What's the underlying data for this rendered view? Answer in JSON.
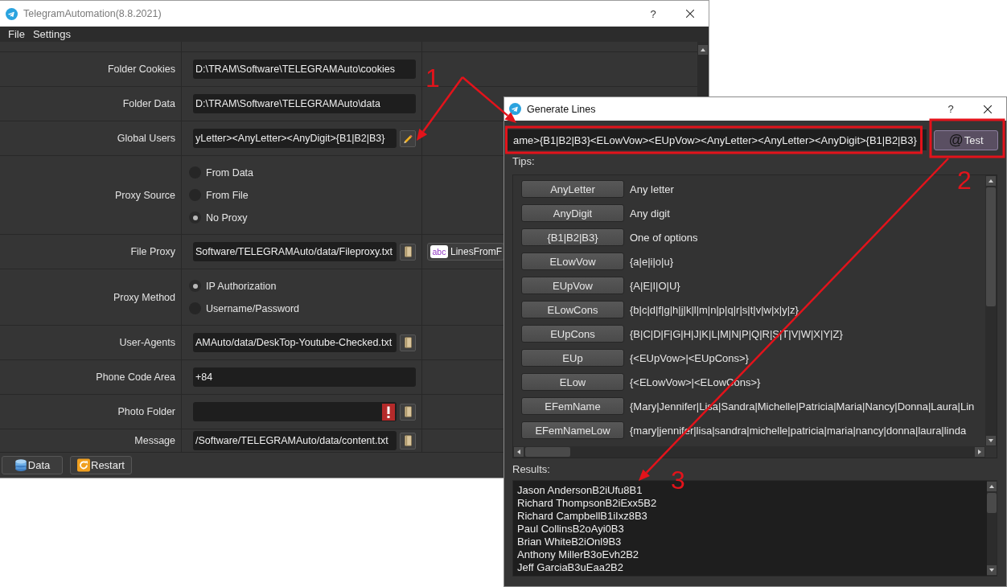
{
  "main_window": {
    "title": "TelegramAutomation(8.8.2021)",
    "help": "?",
    "menu": [
      "File",
      "Settings"
    ],
    "settings": [
      {
        "kind": "text",
        "label": "Folder Cookies",
        "value": "D:\\TRAM\\Software\\TELEGRAMAuto\\cookies"
      },
      {
        "kind": "text",
        "label": "Folder Data",
        "value": "D:\\TRAM\\Software\\TELEGRAMAuto\\data"
      },
      {
        "kind": "edit",
        "label": "Global Users",
        "value": "yLetter><AnyLetter><AnyDigit>{B1|B2|B3}"
      },
      {
        "kind": "radio",
        "label": "Proxy Source",
        "options": [
          {
            "label": "From Data",
            "selected": false
          },
          {
            "label": "From File",
            "selected": false
          },
          {
            "label": "No Proxy",
            "selected": true
          }
        ]
      },
      {
        "kind": "file",
        "label": "File Proxy",
        "value": "Software/TELEGRAMAuto/data/Fileproxy.txt",
        "extra_button": {
          "badge": "abc",
          "label": "LinesFromF"
        }
      },
      {
        "kind": "radio",
        "label": "Proxy Method",
        "options": [
          {
            "label": "IP Authorization",
            "selected": true
          },
          {
            "label": "Username/Password",
            "selected": false
          }
        ]
      },
      {
        "kind": "file",
        "label": "User-Agents",
        "value": "AMAuto/data/DeskTop-Youtube-Checked.txt"
      },
      {
        "kind": "text",
        "label": "Phone Code Area",
        "value": "+84"
      },
      {
        "kind": "file",
        "label": "Photo Folder",
        "error": true
      },
      {
        "kind": "file",
        "label": "Message",
        "value": "/Software/TELEGRAMAuto/data/content.txt"
      }
    ],
    "footer_buttons": [
      {
        "kind": "database",
        "label": "Data"
      },
      {
        "kind": "restart",
        "label": "Restart"
      }
    ]
  },
  "generate_dialog": {
    "title": "Generate Lines",
    "help": "?",
    "pattern": "ame>{B1|B2|B3}<ELowVow><EUpVow><AnyLetter><AnyLetter><AnyDigit>{B1|B2|B3}",
    "test_button": {
      "symbol": "@",
      "label": "Test"
    },
    "tips_label": "Tips:",
    "tips": [
      {
        "token": "AnyLetter",
        "description": "Any letter"
      },
      {
        "token": "AnyDigit",
        "description": "Any digit"
      },
      {
        "token": "{B1|B2|B3}",
        "description": "One of options"
      },
      {
        "token": "ELowVow",
        "description": "{a|e|i|o|u}"
      },
      {
        "token": "EUpVow",
        "description": "{A|E|I|O|U}"
      },
      {
        "token": "ELowCons",
        "description": "{b|c|d|f|g|h|j|k|l|m|n|p|q|r|s|t|v|w|x|y|z}"
      },
      {
        "token": "EUpCons",
        "description": "{B|C|D|F|G|H|J|K|L|M|N|P|Q|R|S|T|V|W|X|Y|Z}"
      },
      {
        "token": "EUp",
        "description": "{<EUpVow>|<EUpCons>}"
      },
      {
        "token": "ELow",
        "description": "{<ELowVow>|<ELowCons>}"
      },
      {
        "token": "EFemName",
        "description": "{Mary|Jennifer|Lisa|Sandra|Michelle|Patricia|Maria|Nancy|Donna|Laura|Lin"
      },
      {
        "token": "EFemNameLow",
        "description": "{mary|jennifer|lisa|sandra|michelle|patricia|maria|nancy|donna|laura|linda"
      }
    ],
    "results_label": "Results:",
    "results": [
      "Jason AndersonB2iUfu8B1",
      "Richard ThompsonB2iExx5B2",
      "Richard CampbellB1iIxz8B3",
      "Paul CollinsB2oAyi0B3",
      "Brian WhiteB2iOnl9B3",
      "Anthony MillerB3oEvh2B2",
      "Jeff GarciaB3uEaa2B2"
    ]
  },
  "callouts": [
    "1",
    "2",
    "3"
  ]
}
